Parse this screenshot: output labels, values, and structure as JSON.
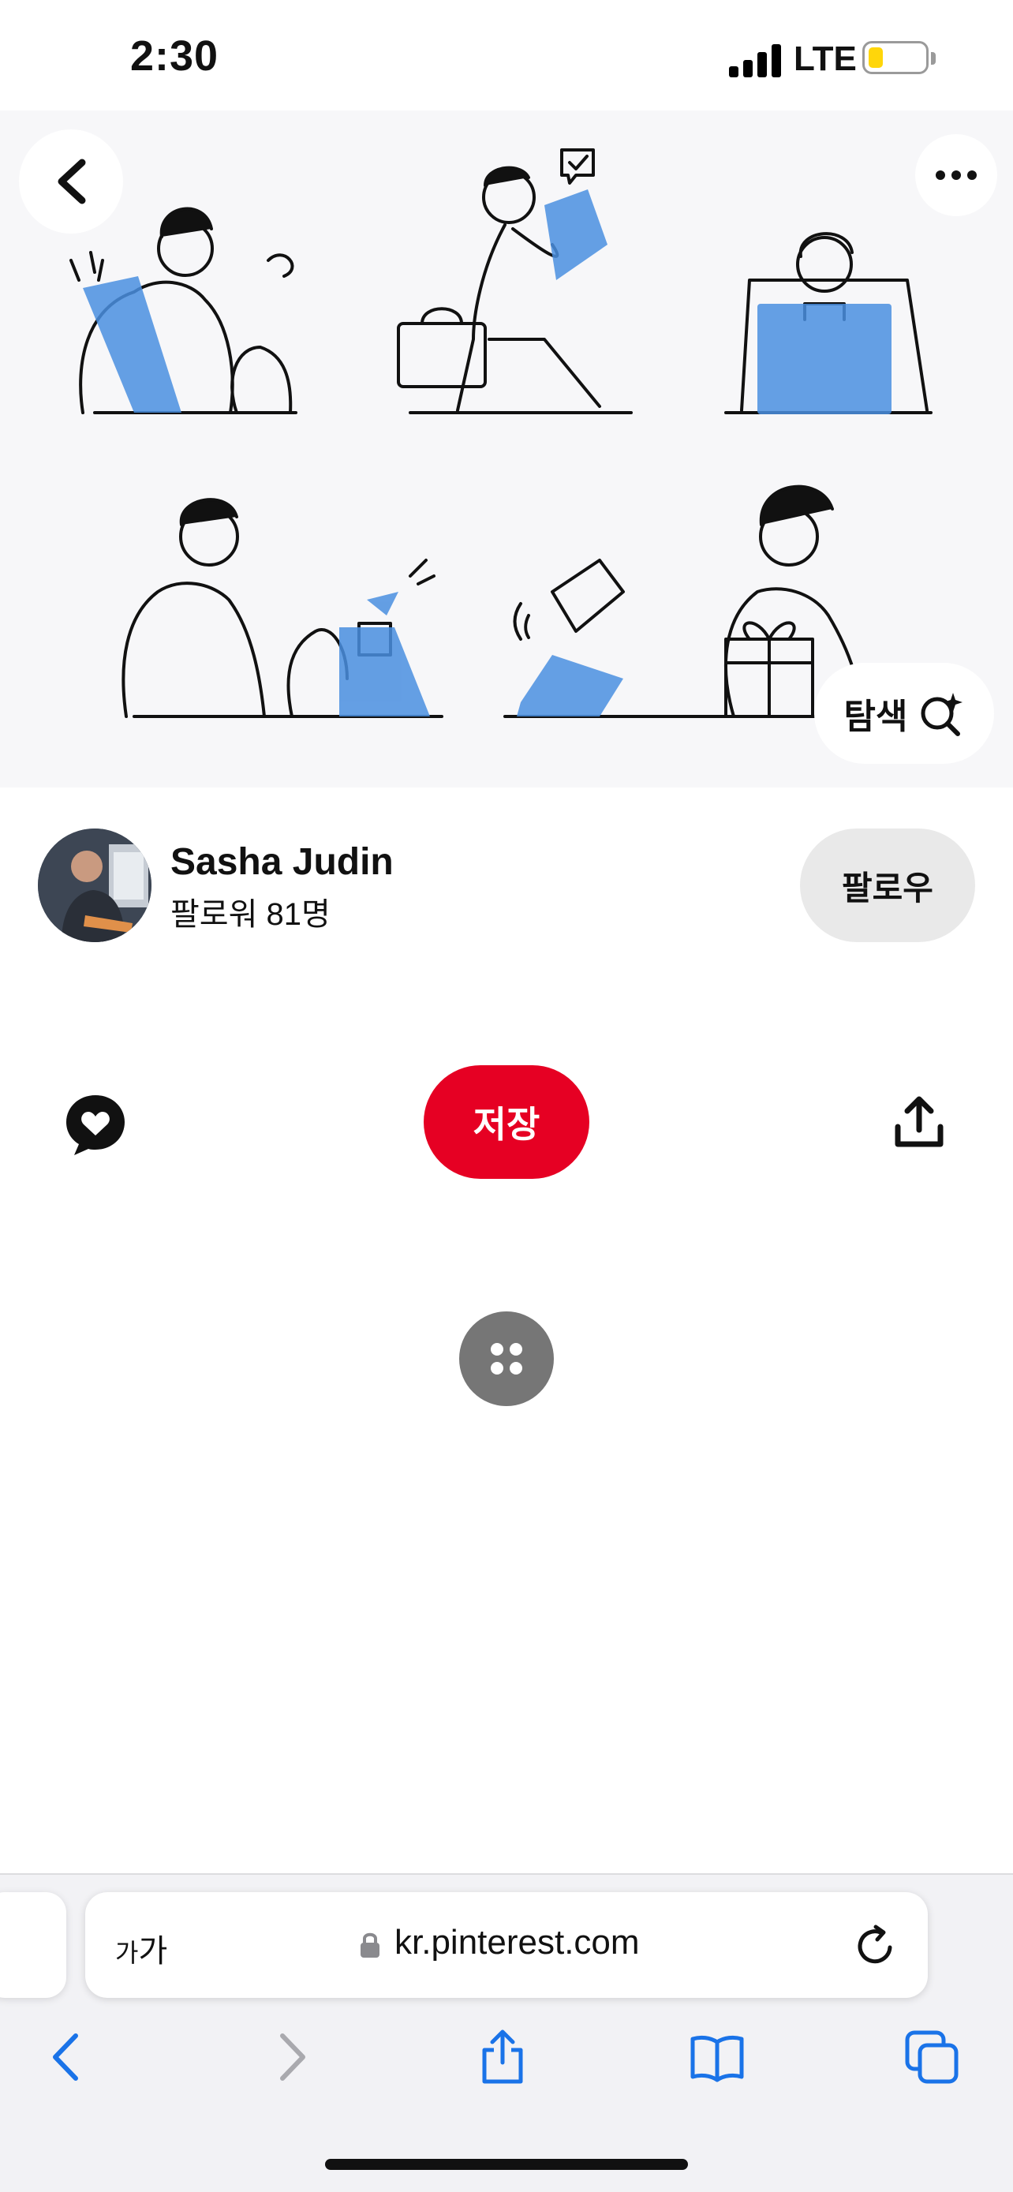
{
  "status_bar": {
    "time": "2:30",
    "network": "LTE",
    "signal_icon": "cellular-signal-icon",
    "battery_icon": "battery-low-icon",
    "battery_level": 0.25,
    "battery_color": "#ffd60a"
  },
  "pin": {
    "image_description_icon": "illustration-grid",
    "back_icon": "chevron-left-icon",
    "more_icon": "ellipsis-icon",
    "explore_label": "탐색",
    "explore_icon": "sparkle-search-icon"
  },
  "creator": {
    "name": "Sasha Judin",
    "followers": "팔로워 81명",
    "follow_label": "팔로우"
  },
  "actions": {
    "comment_icon": "heart-speech-bubble-icon",
    "save_label": "저장",
    "save_color": "#e60023",
    "share_icon": "share-upload-icon",
    "more_pins_icon": "four-dots-icon"
  },
  "browser": {
    "text_size_label_small": "가",
    "text_size_label_large": "가",
    "url": "kr.pinterest.com",
    "lock_icon": "lock-icon",
    "reload_icon": "reload-icon",
    "toolbar": {
      "back_icon": "chevron-left-icon",
      "forward_icon": "chevron-right-icon",
      "share_icon": "share-icon",
      "bookmarks_icon": "open-book-icon",
      "tabs_icon": "tabs-icon"
    },
    "accent_color": "#1a73e8"
  }
}
